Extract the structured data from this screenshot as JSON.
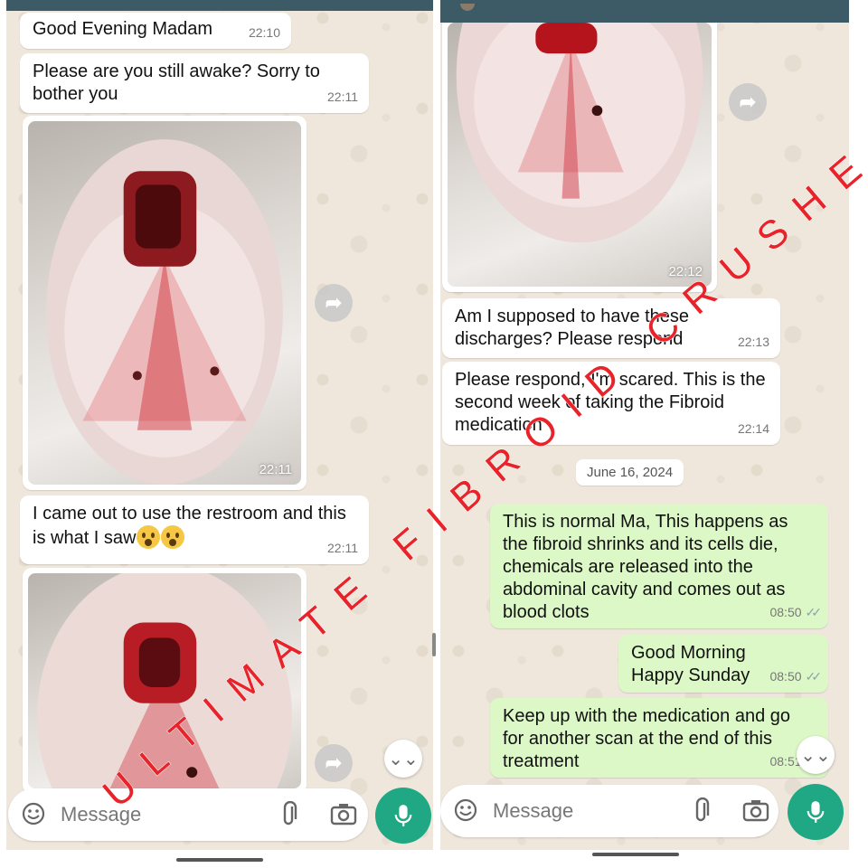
{
  "left": {
    "messages": [
      {
        "text": "Good Evening Madam",
        "time": "22:10"
      },
      {
        "text": "Please are you still awake? Sorry to bother you",
        "time": "22:11"
      },
      {
        "image_time": "22:11"
      },
      {
        "text": "I came out to use the restroom and this is what I saw",
        "time": "22:11",
        "emojis": "😲😲"
      }
    ],
    "input_placeholder": "Message"
  },
  "right": {
    "image_time": "22:12",
    "messages": [
      {
        "text": "Am I supposed to have these discharges? Please respond",
        "time": "22:13"
      },
      {
        "text": "Please respond, I'm scared. This is the second week of taking the Fibroid medication",
        "time": "22:14"
      }
    ],
    "date_chip": "June 16, 2024",
    "outgoing": [
      {
        "text": "This is normal Ma, This happens as the fibroid shrinks and its cells die, chemicals are released into the abdominal cavity and comes out as blood clots",
        "time": "08:50"
      },
      {
        "text": "Good Morning\nHappy Sunday",
        "time": "08:50"
      },
      {
        "text": "Keep up with the medication and go for another scan at the end of this treatment",
        "time": "08:51"
      }
    ],
    "input_placeholder": "Message"
  },
  "watermark": "ULTIMATE FIBROID CRUSHER",
  "colors": {
    "watermark": "#e8232a",
    "mic": "#1fa883",
    "outgoing_bubble": "#dcf8c6",
    "topbar": "#3d5a67"
  },
  "icons": [
    "forward-icon",
    "scroll-down-icon",
    "emoji-icon",
    "attach-icon",
    "camera-icon",
    "mic-icon",
    "double-check-icon"
  ]
}
